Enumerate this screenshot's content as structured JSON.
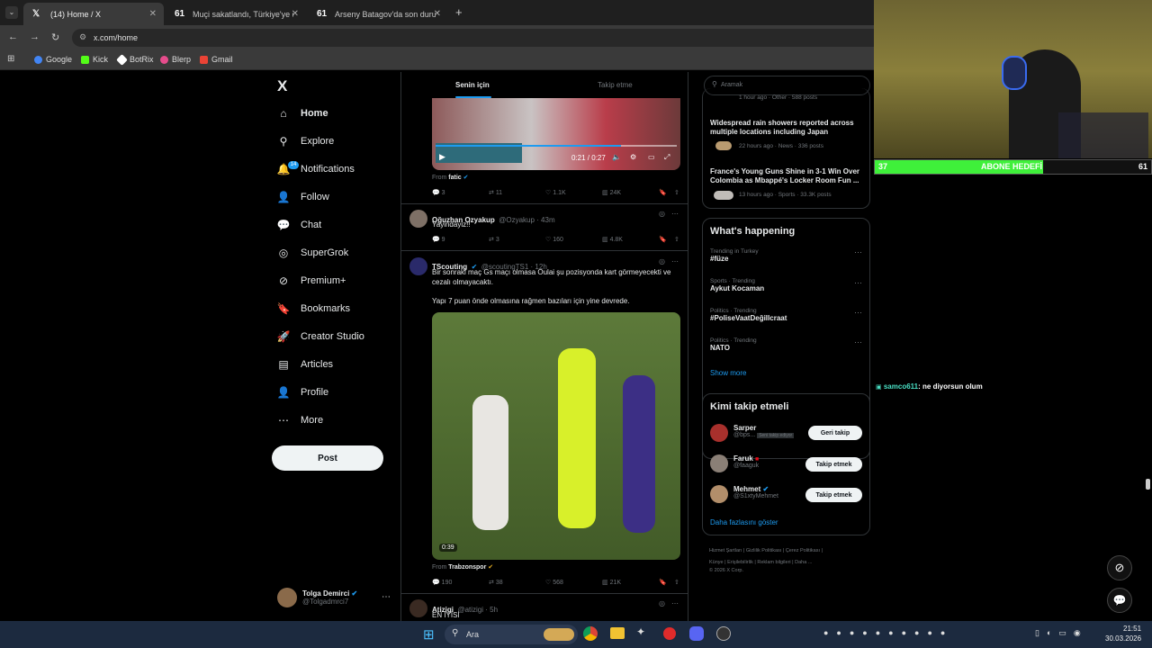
{
  "browser": {
    "tabs": [
      {
        "title": "(14) Home / X",
        "icon": "x-logo-icon"
      },
      {
        "title": "Muçi sakatlandı, Türkiye'ye dön",
        "icon": "site-61-icon"
      },
      {
        "title": "Arseny Batagov'da son durum!",
        "icon": "site-61-icon"
      }
    ],
    "new_tab": "+",
    "url": "x.com/home",
    "bookmarks": [
      {
        "label": "Google",
        "color": "#4285f4"
      },
      {
        "label": "Kick",
        "color": "#53fc18"
      },
      {
        "label": "BotRix",
        "color": "#ffffff"
      },
      {
        "label": "Blerp",
        "color": "#e64c8c"
      },
      {
        "label": "Gmail",
        "color": "#ea4335"
      }
    ]
  },
  "sidebar": {
    "logo": "X",
    "items": [
      {
        "label": "Home",
        "icon": "home-icon",
        "glyph": "⌂"
      },
      {
        "label": "Explore",
        "icon": "search-icon",
        "glyph": "⚲"
      },
      {
        "label": "Notifications",
        "icon": "bell-icon",
        "glyph": "🔔"
      },
      {
        "label": "Follow",
        "icon": "person-add-icon",
        "glyph": "👤"
      },
      {
        "label": "Chat",
        "icon": "chat-icon",
        "glyph": "💬"
      },
      {
        "label": "SuperGrok",
        "icon": "grok-icon",
        "glyph": "◎"
      },
      {
        "label": "Premium+",
        "icon": "premium-icon",
        "glyph": "⊘"
      },
      {
        "label": "Bookmarks",
        "icon": "bookmark-icon",
        "glyph": "🔖"
      },
      {
        "label": "Creator Studio",
        "icon": "rocket-icon",
        "glyph": "🚀"
      },
      {
        "label": "Articles",
        "icon": "article-icon",
        "glyph": "▤"
      },
      {
        "label": "Profile",
        "icon": "profile-icon",
        "glyph": "👤"
      },
      {
        "label": "More",
        "icon": "more-icon",
        "glyph": "⋯"
      }
    ],
    "notifications_badge": "14",
    "post_label": "Post",
    "account": {
      "name": "Tolga Demirci",
      "handle": "@Tolgadmrci7"
    }
  },
  "feed": {
    "tabs": [
      "Senin için",
      "Takip etme"
    ],
    "tweet0": {
      "video_time": "0:21 / 0:27",
      "from_label": "From",
      "from_source": "fatic",
      "replies": "3",
      "reposts": "11",
      "likes": "1.1K",
      "views": "24K"
    },
    "tweet1": {
      "name": "Oğuzhan Ozyakup",
      "handle": "@Ozyakup · 43m",
      "text": "Yayindayiz!!",
      "replies": "9",
      "reposts": "3",
      "likes": "160",
      "views": "4.8K"
    },
    "tweet2": {
      "name": "TScouting",
      "handle": "@scoutingTS1 · 12h",
      "text1": "Bir sonraki maç Gs maçı olmasa Oulai şu pozisyonda kart görmeyecekti ve cezalı olmayacaktı.",
      "text2": "Yapı 7 puan önde olmasına rağmen bazıları için yine devrede.",
      "video_duration": "0:39",
      "from_label": "From",
      "from_source": "Trabzonspor",
      "replies": "190",
      "reposts": "38",
      "likes": "568",
      "views": "21K"
    },
    "tweet3": {
      "name": "Atizigi",
      "handle": "@atizigi · 5h",
      "text": "EN İYİSİ"
    }
  },
  "right": {
    "search_placeholder": "Aramak",
    "news": [
      {
        "meta": "1 hour ago · Other · 588 posts"
      },
      {
        "title": "Widespread rain showers reported across multiple locations including Japan",
        "meta": "22 hours ago · News · 336 posts"
      },
      {
        "title": "France's Young Guns Shine in 3-1 Win Over Colombia as Mbappé's Locker Room Fun ...",
        "meta": "13 hours ago · Sports · 33.3K posts"
      }
    ],
    "happening_title": "What's happening",
    "trends": [
      {
        "meta": "Trending in Turkey",
        "topic": "#füze"
      },
      {
        "meta": "Sports · Trending",
        "topic": "Aykut Kocaman"
      },
      {
        "meta": "Politics · Trending",
        "topic": "#PoliseVaatDeğilIcraat"
      },
      {
        "meta": "Politics · Trending",
        "topic": "NATO"
      }
    ],
    "show_more": "Show more",
    "who_title": "Kimi takip etmeli",
    "who": [
      {
        "name": "Sarper",
        "handle": "@bps...",
        "badge": "Seni takip ediyor",
        "button": "Geri takip"
      },
      {
        "name": "Faruk",
        "handle": "@faaguk",
        "button": "Takip etmek"
      },
      {
        "name": "Mehmet",
        "handle": "@S1xtyMehmet",
        "button": "Takip etmek"
      }
    ],
    "who_more": "Daha fazlasını göster",
    "footer": [
      "Hizmet Şartları",
      "Gizlilik Politikası",
      "Çerez Politikası",
      "Künye",
      "Erişilebilirlik",
      "Reklam bilgileri",
      "Daha ...",
      "© 2026 X Corp."
    ]
  },
  "stream": {
    "abone_label": "ABONE HEDEFİ",
    "abone_current": "37",
    "abone_goal": "61",
    "abone_progress": 0.61,
    "chat": {
      "user": "samco611",
      "message": ": ne diyorsun olum"
    }
  },
  "taskbar": {
    "search_label": "Ara",
    "time": "21:51",
    "date": "30.03.2026"
  },
  "colors": {
    "accent": "#1d9bf0",
    "abone_bar": "#3ff03a",
    "chat_user": "#49e0c5"
  }
}
